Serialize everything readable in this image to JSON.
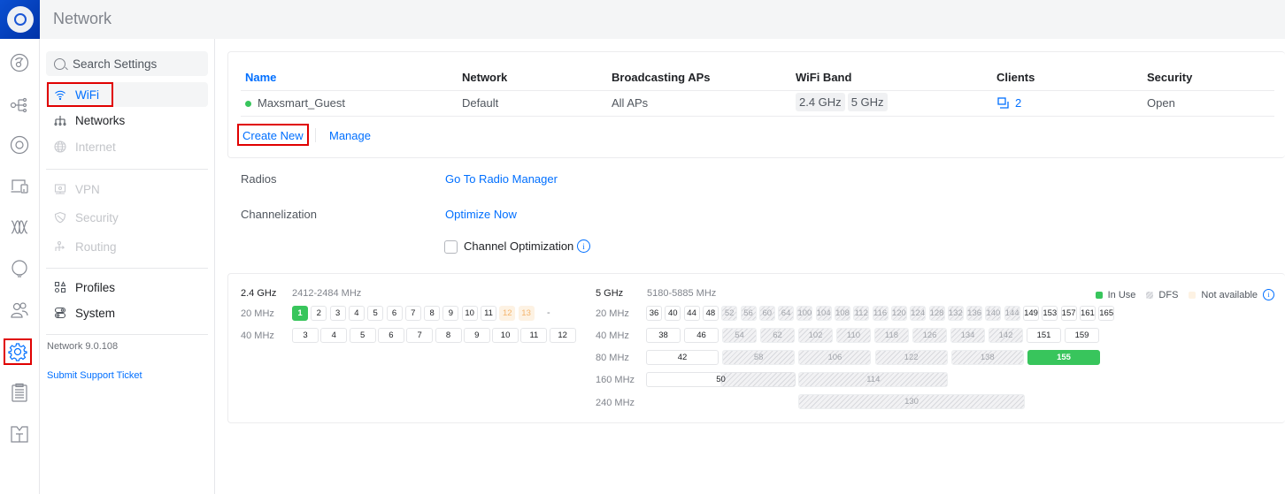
{
  "app": {
    "title": "Network"
  },
  "rail": {
    "items": [
      {
        "name": "dashboard-icon"
      },
      {
        "name": "topology-icon"
      },
      {
        "name": "unifi-devices-icon"
      },
      {
        "name": "client-devices-icon"
      },
      {
        "name": "statistics-icon"
      },
      {
        "name": "insights-icon"
      },
      {
        "name": "hotspot-users-icon"
      },
      {
        "name": "settings-icon",
        "active": true
      },
      {
        "name": "system-log-icon"
      },
      {
        "name": "floorplan-icon"
      }
    ]
  },
  "sidebar": {
    "search_placeholder": "Search Settings",
    "items": [
      {
        "label": "WiFi",
        "icon": "wifi-icon",
        "state": "active"
      },
      {
        "label": "Networks",
        "icon": "networks-icon",
        "state": "normal"
      },
      {
        "label": "Internet",
        "icon": "globe-icon",
        "state": "disabled"
      },
      {
        "label": "VPN",
        "icon": "vpn-icon",
        "state": "disabled"
      },
      {
        "label": "Security",
        "icon": "shield-icon",
        "state": "disabled"
      },
      {
        "label": "Routing",
        "icon": "routing-icon",
        "state": "disabled"
      },
      {
        "label": "Profiles",
        "icon": "profiles-icon",
        "state": "normal"
      },
      {
        "label": "System",
        "icon": "system-icon",
        "state": "normal"
      }
    ],
    "version": "Network 9.0.108",
    "support_link": "Submit Support Ticket"
  },
  "wifi_table": {
    "columns": [
      "Name",
      "Network",
      "Broadcasting APs",
      "WiFi Band",
      "Clients",
      "Security"
    ],
    "rows": [
      {
        "name": "Maxsmart_Guest",
        "status_color": "#38c55c",
        "network": "Default",
        "broadcasting_aps": "All APs",
        "bands": [
          "2.4 GHz",
          "5 GHz"
        ],
        "clients": "2",
        "security": "Open"
      }
    ],
    "actions": {
      "create_new": "Create New",
      "manage": "Manage"
    }
  },
  "radios": {
    "radios_label": "Radios",
    "radios_link": "Go To Radio Manager",
    "channelization_label": "Channelization",
    "optimize_link": "Optimize Now",
    "channel_optimization_label": "Channel Optimization",
    "channel_optimization_checked": false
  },
  "channels": {
    "legend": {
      "in_use": "In Use",
      "dfs": "DFS",
      "not_available": "Not available"
    },
    "colors": {
      "in_use": "#38c55c",
      "not_available": "#fdf2e3",
      "link": "#006fff"
    },
    "band_24": {
      "title": "2.4 GHz",
      "range": "2412-2484 MHz",
      "w20_label": "20 MHz",
      "w20": [
        {
          "ch": "1",
          "state": "inuse"
        },
        {
          "ch": "2",
          "state": "free"
        },
        {
          "ch": "3",
          "state": "free"
        },
        {
          "ch": "4",
          "state": "free"
        },
        {
          "ch": "5",
          "state": "free"
        },
        {
          "ch": "6",
          "state": "free"
        },
        {
          "ch": "7",
          "state": "free"
        },
        {
          "ch": "8",
          "state": "free"
        },
        {
          "ch": "9",
          "state": "free"
        },
        {
          "ch": "10",
          "state": "free"
        },
        {
          "ch": "11",
          "state": "free"
        },
        {
          "ch": "12",
          "state": "na"
        },
        {
          "ch": "13",
          "state": "na"
        }
      ],
      "w20_trailing": "-",
      "w40_label": "40 MHz",
      "w40": [
        "3",
        "4",
        "5",
        "6",
        "7",
        "8",
        "9",
        "10",
        "11",
        "12"
      ]
    },
    "band_5": {
      "title": "5 GHz",
      "range": "5180-5885 MHz",
      "w20_label": "20 MHz",
      "w20": [
        {
          "ch": "36",
          "state": "free"
        },
        {
          "ch": "40",
          "state": "free"
        },
        {
          "ch": "44",
          "state": "free"
        },
        {
          "ch": "48",
          "state": "free"
        },
        {
          "ch": "52",
          "state": "dfs"
        },
        {
          "ch": "56",
          "state": "dfs"
        },
        {
          "ch": "60",
          "state": "dfs"
        },
        {
          "ch": "64",
          "state": "dfs"
        },
        {
          "ch": "100",
          "state": "dfs"
        },
        {
          "ch": "104",
          "state": "dfs"
        },
        {
          "ch": "108",
          "state": "dfs"
        },
        {
          "ch": "112",
          "state": "dfs"
        },
        {
          "ch": "116",
          "state": "dfs"
        },
        {
          "ch": "120",
          "state": "dfs"
        },
        {
          "ch": "124",
          "state": "dfs"
        },
        {
          "ch": "128",
          "state": "dfs"
        },
        {
          "ch": "132",
          "state": "dfs"
        },
        {
          "ch": "136",
          "state": "dfs"
        },
        {
          "ch": "140",
          "state": "dfs"
        },
        {
          "ch": "144",
          "state": "dfs"
        },
        {
          "ch": "149",
          "state": "free"
        },
        {
          "ch": "153",
          "state": "free"
        },
        {
          "ch": "157",
          "state": "free"
        },
        {
          "ch": "161",
          "state": "free"
        },
        {
          "ch": "165",
          "state": "free"
        }
      ],
      "w40_label": "40 MHz",
      "w40": [
        {
          "ch": "38",
          "state": "free"
        },
        {
          "ch": "46",
          "state": "free"
        },
        {
          "ch": "54",
          "state": "dfs"
        },
        {
          "ch": "62",
          "state": "dfs"
        },
        {
          "ch": "102",
          "state": "dfs"
        },
        {
          "ch": "110",
          "state": "dfs"
        },
        {
          "ch": "118",
          "state": "dfs"
        },
        {
          "ch": "126",
          "state": "dfs"
        },
        {
          "ch": "134",
          "state": "dfs"
        },
        {
          "ch": "142",
          "state": "dfs"
        },
        {
          "ch": "151",
          "state": "free"
        },
        {
          "ch": "159",
          "state": "free"
        }
      ],
      "w80_label": "80 MHz",
      "w80": [
        {
          "ch": "42",
          "state": "free"
        },
        {
          "ch": "58",
          "state": "dfs"
        },
        {
          "ch": "106",
          "state": "dfs"
        },
        {
          "ch": "122",
          "state": "dfs"
        },
        {
          "ch": "138",
          "state": "dfs"
        },
        {
          "ch": "155",
          "state": "inuse"
        }
      ],
      "w160_label": "160 MHz",
      "w160": [
        {
          "ch": "50",
          "state": "split"
        },
        {
          "ch": "114",
          "state": "dfs"
        }
      ],
      "w240_label": "240 MHz",
      "w240": [
        {
          "ch": "130",
          "state": "dfs"
        }
      ]
    }
  }
}
